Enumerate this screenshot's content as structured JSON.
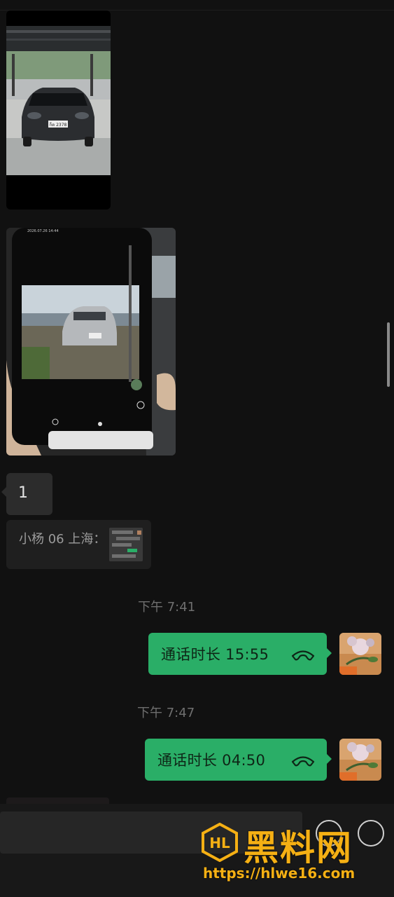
{
  "messages": {
    "text_1": "1",
    "quote_text": "小杨 06 上海：",
    "time_1": "下午 7:41",
    "call_1": "通话时长 15:55",
    "time_2": "下午 7:47",
    "call_2": "通话时长 04:50"
  },
  "photos": {
    "car_plate": "ก็ต 2378",
    "screen_date": "2026.07.26 14:44"
  },
  "watermark": {
    "brand": "黑料网",
    "url": "https://hlwe16.com"
  },
  "colors": {
    "background": "#111111",
    "incoming_bubble": "#2c2c2c",
    "outgoing_bubble": "#2aae67",
    "watermark": "#f5b014"
  },
  "icons": [
    "phone-hangup-icon",
    "emoji-icon",
    "plus-icon"
  ]
}
